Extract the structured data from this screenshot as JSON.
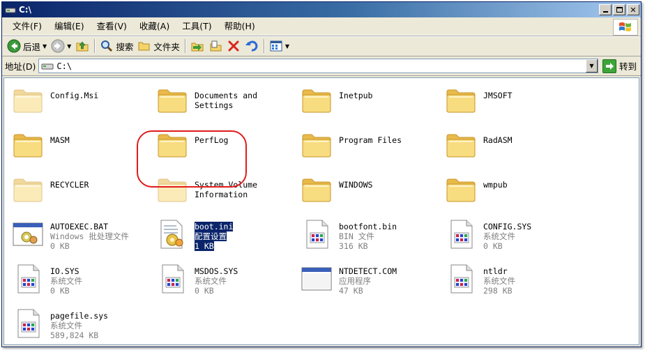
{
  "window": {
    "title": "C:\\"
  },
  "menu": [
    {
      "label": "文件(F)"
    },
    {
      "label": "编辑(E)"
    },
    {
      "label": "查看(V)"
    },
    {
      "label": "收藏(A)"
    },
    {
      "label": "工具(T)"
    },
    {
      "label": "帮助(H)"
    }
  ],
  "toolbar": {
    "back_label": "后退",
    "search_label": "搜索",
    "folders_label": "文件夹"
  },
  "address": {
    "label": "地址(D)",
    "value": "C:\\",
    "go_label": "转到"
  },
  "folders": [
    {
      "name": "Config.Msi",
      "faded": true
    },
    {
      "name": "Documents and\nSettings",
      "faded": false
    },
    {
      "name": "Inetpub",
      "faded": false
    },
    {
      "name": "JMSOFT",
      "faded": false
    },
    {
      "name": "MASM",
      "faded": false
    },
    {
      "name": "PerfLog",
      "faded": false
    },
    {
      "name": "Program Files",
      "faded": false
    },
    {
      "name": "RadASM",
      "faded": false
    },
    {
      "name": "RECYCLER",
      "faded": true
    },
    {
      "name": "System Volume\nInformation",
      "faded": true
    },
    {
      "name": "WINDOWS",
      "faded": false
    },
    {
      "name": "wmpub",
      "faded": false
    }
  ],
  "files": [
    {
      "name": "AUTOEXEC.BAT",
      "type": "Windows 批处理文件",
      "size": "0 KB",
      "icon": "batch-file-icon"
    },
    {
      "name": "boot.ini",
      "type": "配置设置",
      "size": "1 KB",
      "icon": "config-file-icon",
      "selected": true
    },
    {
      "name": "bootfont.bin",
      "type": "BIN 文件",
      "size": "316 KB",
      "icon": "system-file-icon"
    },
    {
      "name": "CONFIG.SYS",
      "type": "系统文件",
      "size": "0 KB",
      "icon": "system-file-icon"
    },
    {
      "name": "IO.SYS",
      "type": "系统文件",
      "size": "0 KB",
      "icon": "system-file-icon"
    },
    {
      "name": "MSDOS.SYS",
      "type": "系统文件",
      "size": "0 KB",
      "icon": "system-file-icon"
    },
    {
      "name": "NTDETECT.COM",
      "type": "应用程序",
      "size": "47 KB",
      "icon": "application-icon"
    },
    {
      "name": "ntldr",
      "type": "系统文件",
      "size": "298 KB",
      "icon": "system-file-icon"
    },
    {
      "name": "pagefile.sys",
      "type": "系统文件",
      "size": "589,824 KB",
      "icon": "system-file-icon"
    }
  ],
  "colors": {
    "titlebar": "#0a246a",
    "selection": "#0a246a",
    "highlight_ring": "#e01b1b",
    "folder": "#f5d36b"
  }
}
